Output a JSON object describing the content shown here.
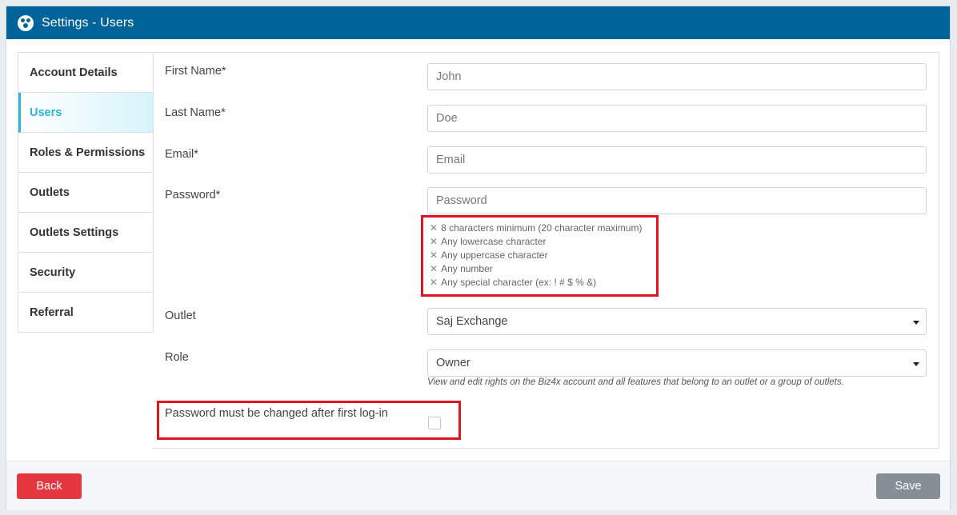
{
  "window": {
    "title": "Settings - Users",
    "icon": "users-circle-icon"
  },
  "sidebar": {
    "items": [
      {
        "label": "Account Details",
        "active": false
      },
      {
        "label": "Users",
        "active": true
      },
      {
        "label": "Roles & Permissions",
        "active": false
      },
      {
        "label": "Outlets",
        "active": false
      },
      {
        "label": "Outlets Settings",
        "active": false
      },
      {
        "label": "Security",
        "active": false
      },
      {
        "label": "Referral",
        "active": false
      }
    ]
  },
  "form": {
    "first_name": {
      "label": "First Name*",
      "placeholder": "John",
      "value": ""
    },
    "last_name": {
      "label": "Last Name*",
      "placeholder": "Doe",
      "value": ""
    },
    "email": {
      "label": "Email*",
      "placeholder": "Email",
      "value": ""
    },
    "password": {
      "label": "Password*",
      "placeholder": "Password",
      "rules_marker": "✕",
      "rules": [
        "8 characters minimum (20 character maximum)",
        "Any lowercase character",
        "Any uppercase character",
        "Any number",
        "Any special character (ex: ! # $ % &)"
      ]
    },
    "outlet": {
      "label": "Outlet",
      "value": "Saj Exchange"
    },
    "role": {
      "label": "Role",
      "value": "Owner",
      "hint": "View and edit rights on the Biz4x account and all features that belong to an outlet or a group of outlets."
    },
    "password_change": {
      "label": "Password must be changed after first log-in",
      "checked": false
    }
  },
  "footer": {
    "back_label": "Back",
    "save_label": "Save"
  },
  "colors": {
    "header": "#00639a",
    "active": "#2bb5d8",
    "highlight": "#e0141e",
    "back": "#e4373f",
    "save": "#868e96"
  }
}
